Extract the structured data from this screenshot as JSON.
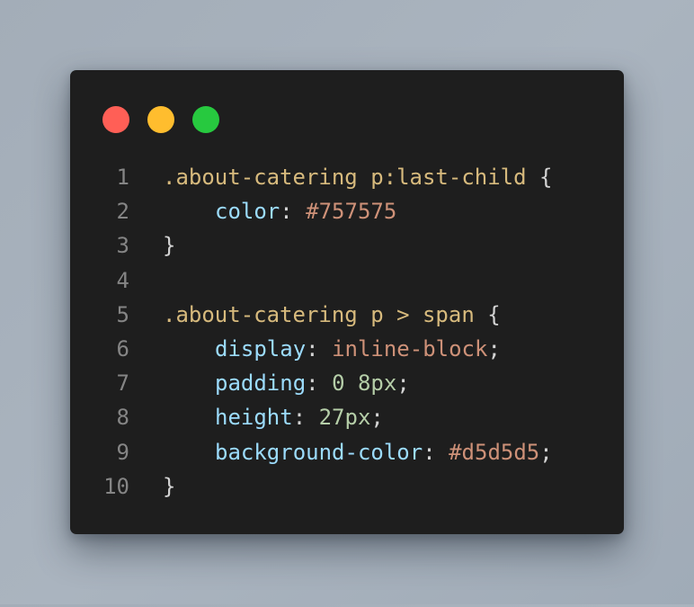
{
  "window": {
    "controls": [
      {
        "name": "close",
        "color": "#ff5f56"
      },
      {
        "name": "minimize",
        "color": "#ffbd2e"
      },
      {
        "name": "maximize",
        "color": "#27c93f"
      }
    ]
  },
  "code": {
    "lines": [
      {
        "num": "1",
        "selector": ".about-catering p:last-child",
        "open": " {"
      },
      {
        "num": "2",
        "prop": "color",
        "sep": ": ",
        "value": "#757575",
        "end": ""
      },
      {
        "num": "3",
        "close": "}"
      },
      {
        "num": "4"
      },
      {
        "num": "5",
        "selector": ".about-catering p > span",
        "open": " {"
      },
      {
        "num": "6",
        "prop": "display",
        "sep": ": ",
        "value": "inline-block",
        "end": ";"
      },
      {
        "num": "7",
        "prop": "padding",
        "sep": ": ",
        "value": "0 8px",
        "end": ";"
      },
      {
        "num": "8",
        "prop": "height",
        "sep": ": ",
        "value": "27px",
        "end": ";"
      },
      {
        "num": "9",
        "prop": "background-color",
        "sep": ": ",
        "value": "#d5d5d5",
        "end": ";"
      },
      {
        "num": "10",
        "close": "}"
      }
    ]
  }
}
